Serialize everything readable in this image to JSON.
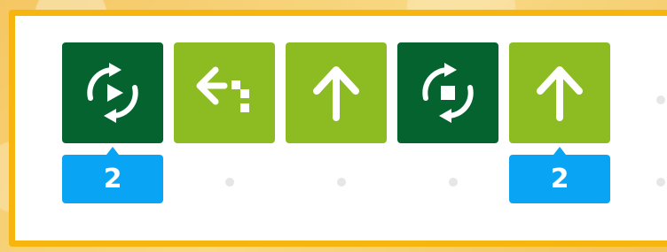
{
  "program": {
    "blocks": [
      {
        "kind": "repeat-start",
        "icon": "repeat-play-icon",
        "color": "#056330",
        "param": "2"
      },
      {
        "kind": "turn-left",
        "icon": "turn-left-arrow-icon",
        "color": "#8cbc22",
        "param": null
      },
      {
        "kind": "move-forward",
        "icon": "up-arrow-icon",
        "color": "#8cbc22",
        "param": null
      },
      {
        "kind": "repeat-end",
        "icon": "repeat-stop-icon",
        "color": "#056330",
        "param": null
      },
      {
        "kind": "move-forward",
        "icon": "up-arrow-icon",
        "color": "#8cbc22",
        "param": "2"
      }
    ]
  },
  "colors": {
    "frame": "#f6b60f",
    "param": "#0aa4f5",
    "dark_block": "#056330",
    "light_block": "#8cbc22"
  }
}
